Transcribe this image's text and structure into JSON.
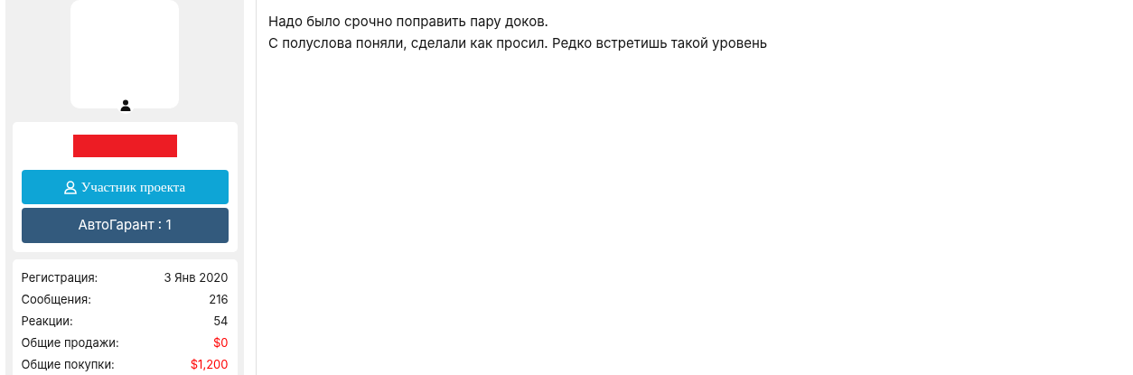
{
  "user": {
    "role_badge": "Участник проекта",
    "guarantee_badge": "АвтоГарант : 1"
  },
  "stats": [
    {
      "label": "Регистрация:",
      "value": "3 Янв 2020",
      "color": "#141414"
    },
    {
      "label": "Сообщения:",
      "value": "216",
      "color": "#141414"
    },
    {
      "label": "Реакции:",
      "value": "54",
      "color": "#141414"
    },
    {
      "label": "Общие продажи:",
      "value": "$0",
      "color": "#ff0000"
    },
    {
      "label": "Общие покупки:",
      "value": "$1,200",
      "color": "#ff0000"
    }
  ],
  "message": {
    "lines": [
      "Надо было срочно поправить пару доков.",
      "С полуслова поняли, сделали как просил. Редко встретишь такой уровень"
    ]
  }
}
